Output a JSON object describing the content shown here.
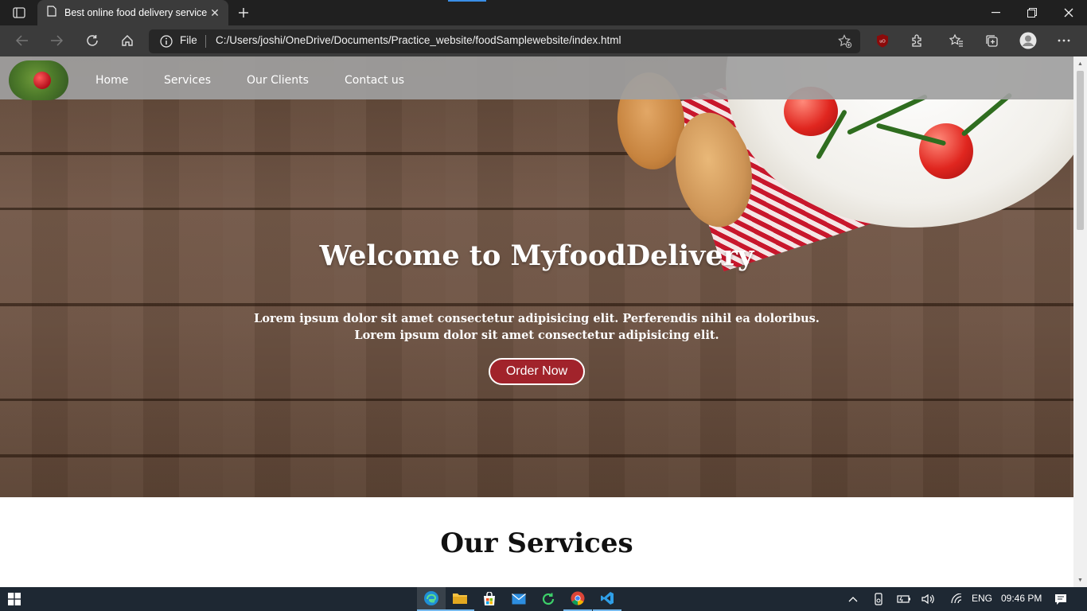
{
  "browser": {
    "tab_title": "Best online food delivery service",
    "tab_close": "✕",
    "new_tab": "+",
    "address_label": "File",
    "url": "C:/Users/joshi/OneDrive/Documents/Practice_website/foodSamplewebsite/index.html",
    "window_controls": {
      "minimize": "—",
      "maximize": "❐",
      "close": "✕"
    },
    "extension_badge": "uO"
  },
  "site": {
    "nav": {
      "items": [
        {
          "label": "Home"
        },
        {
          "label": "Services"
        },
        {
          "label": "Our Clients"
        },
        {
          "label": "Contact us"
        }
      ]
    },
    "hero": {
      "title": "Welcome to MyfoodDelivery",
      "line1": "Lorem ipsum dolor sit amet consectetur adipisicing elit. Perferendis nihil ea doloribus.",
      "line2": "Lorem ipsum dolor sit amet consectetur adipisicing elit.",
      "button_label": "Order Now"
    },
    "services_heading": "Our Services"
  },
  "taskbar": {
    "language": "ENG",
    "time": "09:46 PM",
    "apps": [
      "edge-icon",
      "file-explorer-icon",
      "store-icon",
      "mail-icon",
      "refresh-app-icon",
      "chrome-icon",
      "vscode-icon"
    ]
  },
  "colors": {
    "order_button": "#a1232b",
    "navbar": "#a0a0a0",
    "browser_dark": "#3b3b3b",
    "taskbar": "#1e2833"
  }
}
